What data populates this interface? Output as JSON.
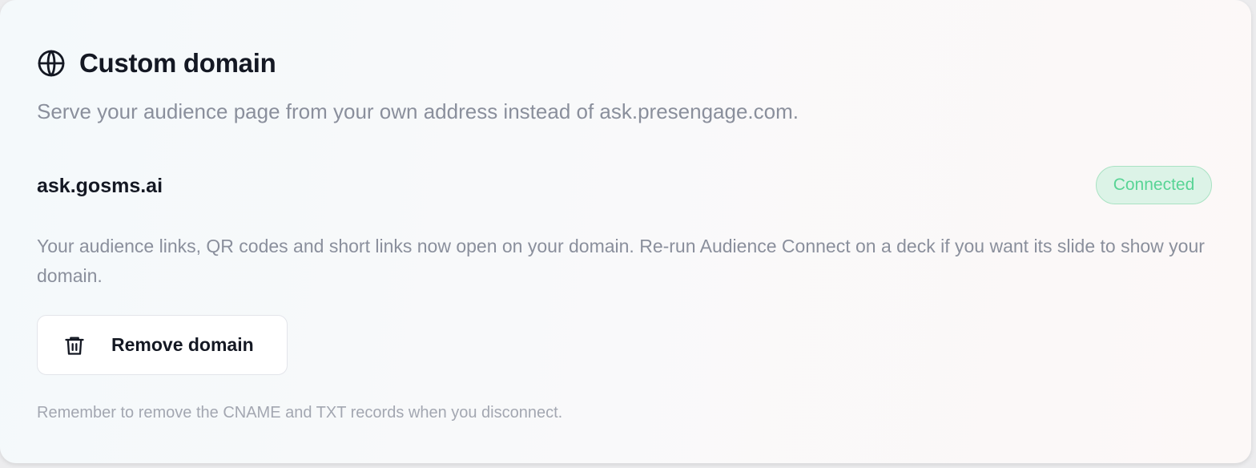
{
  "card": {
    "title": "Custom domain",
    "title_icon": "globe-icon",
    "subtitle": "Serve your audience page from your own address instead of ask.presengage.com.",
    "domain": "ask.gosms.ai",
    "status": {
      "label": "Connected",
      "color": "#58d495"
    },
    "description": "Your audience links, QR codes and short links now open on your domain. Re-run Audience Connect on a deck if you want its slide to show your domain.",
    "remove_button": {
      "label": "Remove domain",
      "icon": "trash-icon"
    },
    "footnote": "Remember to remove the CNAME and TXT records when you disconnect."
  }
}
